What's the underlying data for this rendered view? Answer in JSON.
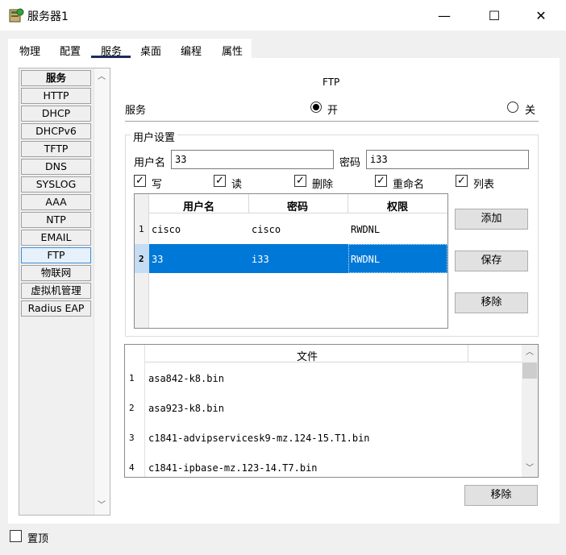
{
  "window": {
    "title": "服务器1",
    "minimize_glyph": "—",
    "maximize_glyph": "☐",
    "close_glyph": "✕"
  },
  "tabs": [
    "物理",
    "配置",
    "服务",
    "桌面",
    "编程",
    "属性"
  ],
  "active_tab": "服务",
  "services": [
    "服务",
    "HTTP",
    "DHCP",
    "DHCPv6",
    "TFTP",
    "DNS",
    "SYSLOG",
    "AAA",
    "NTP",
    "EMAIL",
    "FTP",
    "物联网",
    "虚拟机管理",
    "Radius EAP"
  ],
  "selected_service": "FTP",
  "ftp": {
    "heading": "FTP",
    "service_label": "服务",
    "on_label": "开",
    "off_label": "关",
    "service_state": "on",
    "user_settings_label": "用户设置",
    "username_label": "用户名",
    "username_value": "33",
    "password_label": "密码",
    "password_value": "i33",
    "permissions": [
      {
        "label": "写",
        "checked": true
      },
      {
        "label": "读",
        "checked": true
      },
      {
        "label": "删除",
        "checked": true
      },
      {
        "label": "重命名",
        "checked": true
      },
      {
        "label": "列表",
        "checked": true
      }
    ],
    "user_table": {
      "columns": [
        "用户名",
        "密码",
        "权限"
      ],
      "rows": [
        {
          "index": "1",
          "username": "cisco",
          "password": "cisco",
          "permission": "RWDNL"
        },
        {
          "index": "2",
          "username": "33",
          "password": "i33",
          "permission": "RWDNL"
        }
      ],
      "selected_index": "2"
    },
    "add_button": "添加",
    "save_button": "保存",
    "remove_button": "移除",
    "files": {
      "column": "文件",
      "rows": [
        {
          "index": "1",
          "name": "asa842-k8.bin"
        },
        {
          "index": "2",
          "name": "asa923-k8.bin"
        },
        {
          "index": "3",
          "name": "c1841-advipservicesk9-mz.124-15.T1.bin"
        },
        {
          "index": "4",
          "name": "c1841-ipbase-mz.123-14.T7.bin"
        }
      ]
    },
    "file_remove_button": "移除"
  },
  "footer": {
    "top_label": "置顶",
    "top_checked": false
  },
  "colors": {
    "accent": "#0078d7",
    "tab_underline": "#1c2b5a"
  }
}
